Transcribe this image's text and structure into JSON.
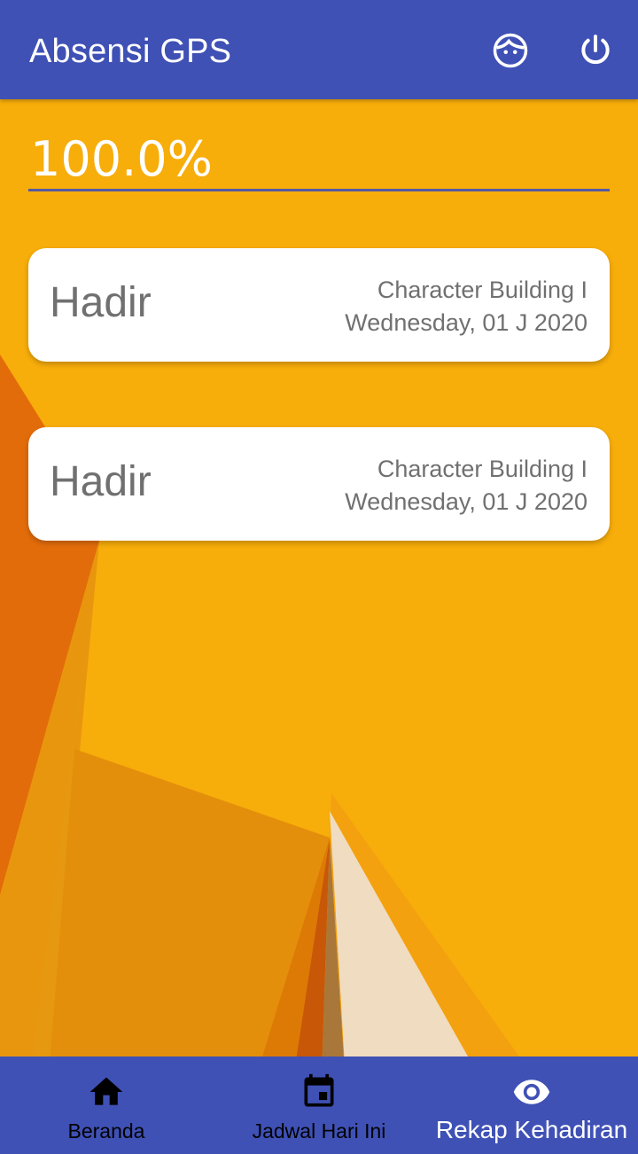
{
  "app_bar": {
    "title": "Absensi GPS",
    "profile_icon": "face-icon",
    "power_icon": "power-icon"
  },
  "summary": {
    "percentage": "100.0%"
  },
  "attendance_cards": [
    {
      "status": "Hadir",
      "subject": "Character Building I",
      "date": "Wednesday, 01 J 2020"
    },
    {
      "status": "Hadir",
      "subject": "Character Building I",
      "date": "Wednesday, 01 J 2020"
    }
  ],
  "bottom_nav": {
    "items": [
      {
        "label": "Beranda",
        "icon": "home-icon",
        "active": false
      },
      {
        "label": "Jadwal Hari Ini",
        "icon": "calendar-event-icon",
        "active": false
      },
      {
        "label": "Rekap Kehadiran",
        "icon": "eye-icon",
        "active": true
      }
    ]
  },
  "colors": {
    "primary": "#3f51b5",
    "background": "#f7ad0a",
    "card_text": "#707070",
    "underline": "#5459a5"
  }
}
